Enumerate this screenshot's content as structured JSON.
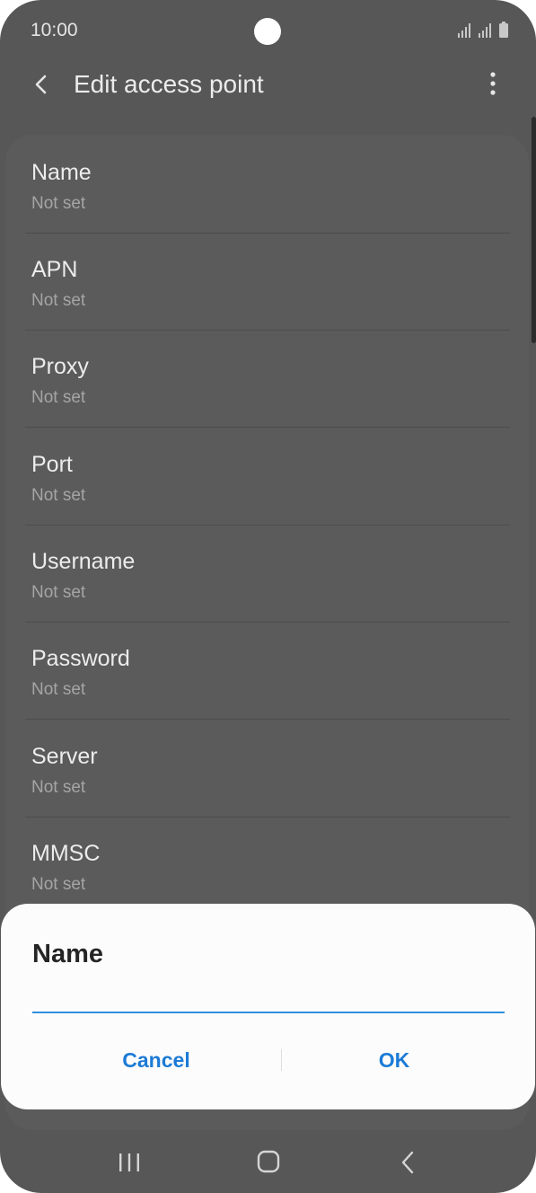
{
  "status_bar": {
    "time": "10:00",
    "icons": [
      "signal-icon",
      "signal-icon",
      "battery-icon"
    ]
  },
  "app_bar": {
    "title": "Edit access point",
    "back_icon": "chevron-left-icon",
    "more_icon": "more-vertical-icon"
  },
  "settings": {
    "items": [
      {
        "label": "Name",
        "value": "Not set"
      },
      {
        "label": "APN",
        "value": "Not set"
      },
      {
        "label": "Proxy",
        "value": "Not set"
      },
      {
        "label": "Port",
        "value": "Not set"
      },
      {
        "label": "Username",
        "value": "Not set"
      },
      {
        "label": "Password",
        "value": "Not set"
      },
      {
        "label": "Server",
        "value": "Not set"
      },
      {
        "label": "MMSC",
        "value": "Not set"
      }
    ]
  },
  "dialog": {
    "title": "Name",
    "input_value": "",
    "cancel_label": "Cancel",
    "ok_label": "OK"
  },
  "nav_bar": {
    "icons": [
      "recents-icon",
      "home-icon",
      "back-icon"
    ]
  },
  "colors": {
    "accent": "#1c7bd6",
    "input_underline": "#2f8fe0",
    "background": "#575757",
    "dialog": "#fcfcfc"
  }
}
